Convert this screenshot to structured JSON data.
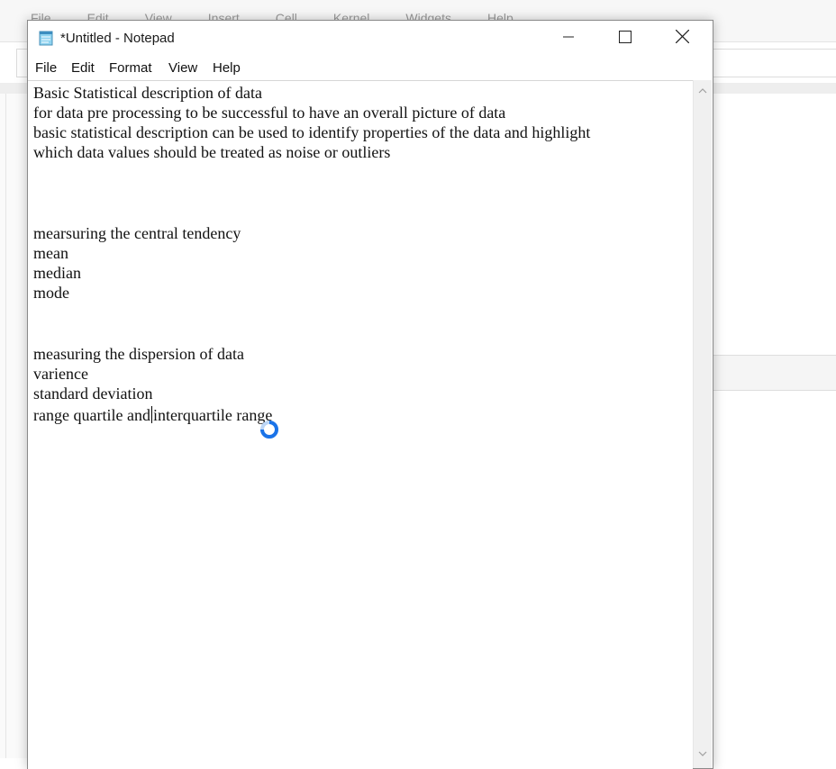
{
  "background_app": {
    "menu": [
      "File",
      "Edit",
      "View",
      "Insert",
      "Cell",
      "Kernel",
      "Widgets",
      "Help"
    ]
  },
  "window": {
    "title": "*Untitled - Notepad",
    "icon": "notepad-icon",
    "controls": {
      "minimize": "minimize-icon",
      "maximize": "maximize-icon",
      "close": "close-icon"
    }
  },
  "menubar": {
    "file": "File",
    "edit": "Edit",
    "format": "Format",
    "view": "View",
    "help": "Help"
  },
  "editor": {
    "lines": [
      "Basic Statistical description of data",
      "for data pre processing to be successful to have an overall picture of data",
      "basic statistical description can be used to identify properties of the data and highlight",
      "which data values should be treated as noise or outliers",
      "mearsuring the central tendency",
      "mean",
      "median",
      "mode",
      "measuring the dispersion of data",
      "varience",
      "standard deviation"
    ],
    "caret_line_before": "range quartile and",
    "caret_line_after": "interquartile range"
  },
  "colors": {
    "accent_cursor": "#1a73e8",
    "text": "#111111",
    "scrollbar": "#f0f0f0"
  }
}
